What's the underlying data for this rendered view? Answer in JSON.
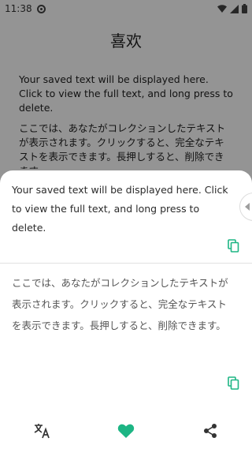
{
  "status_bar": {
    "time": "11:38"
  },
  "page": {
    "title": "喜欢",
    "notes": [
      "Your saved text will be displayed here. Click to view the full text, and long press to delete.",
      "ここでは、あなたがコレクションしたテキストが表示されます。クリックすると、完全なテキストを表示できます。長押しすると、削除できます。"
    ]
  },
  "sheet": {
    "cards": [
      {
        "text": "Your saved text will be displayed here. Click to view the full text, and long press to delete."
      },
      {
        "text": "ここでは、あなたがコレクションしたテキストが表示されます。クリックすると、完全なテキストを表示できます。長押しすると、削除できます。"
      }
    ]
  },
  "icons": {
    "copy": "copy-icon",
    "translate": "translate-icon",
    "favorite": "heart-icon",
    "share": "share-icon",
    "handle": "chevron-left-icon"
  },
  "colors": {
    "accent": "#1db584",
    "scrim": "#000000",
    "text": "#2b2b2b"
  }
}
